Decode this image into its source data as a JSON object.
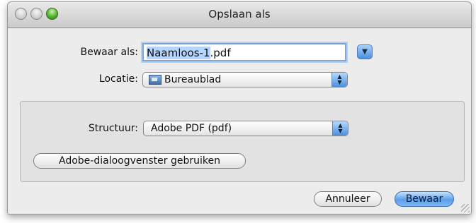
{
  "window": {
    "title": "Opslaan als"
  },
  "save_as": {
    "label": "Bewaar als:",
    "value_selected": "Naamloos-1",
    "value_ext": ".pdf",
    "expand_glyph": "▼"
  },
  "location": {
    "label": "Locatie:",
    "value": "Bureaublad",
    "icon": "desktop-folder-icon"
  },
  "format": {
    "label": "Structuur:",
    "value": "Adobe PDF (pdf)"
  },
  "adobe_dialog_button": "Adobe-dialoogvenster gebruiken",
  "buttons": {
    "cancel": "Annuleer",
    "save": "Bewaar"
  },
  "colors": {
    "accent": "#5c9eea",
    "window_bg": "#ececec",
    "panel_bg": "#e2e2e2"
  }
}
